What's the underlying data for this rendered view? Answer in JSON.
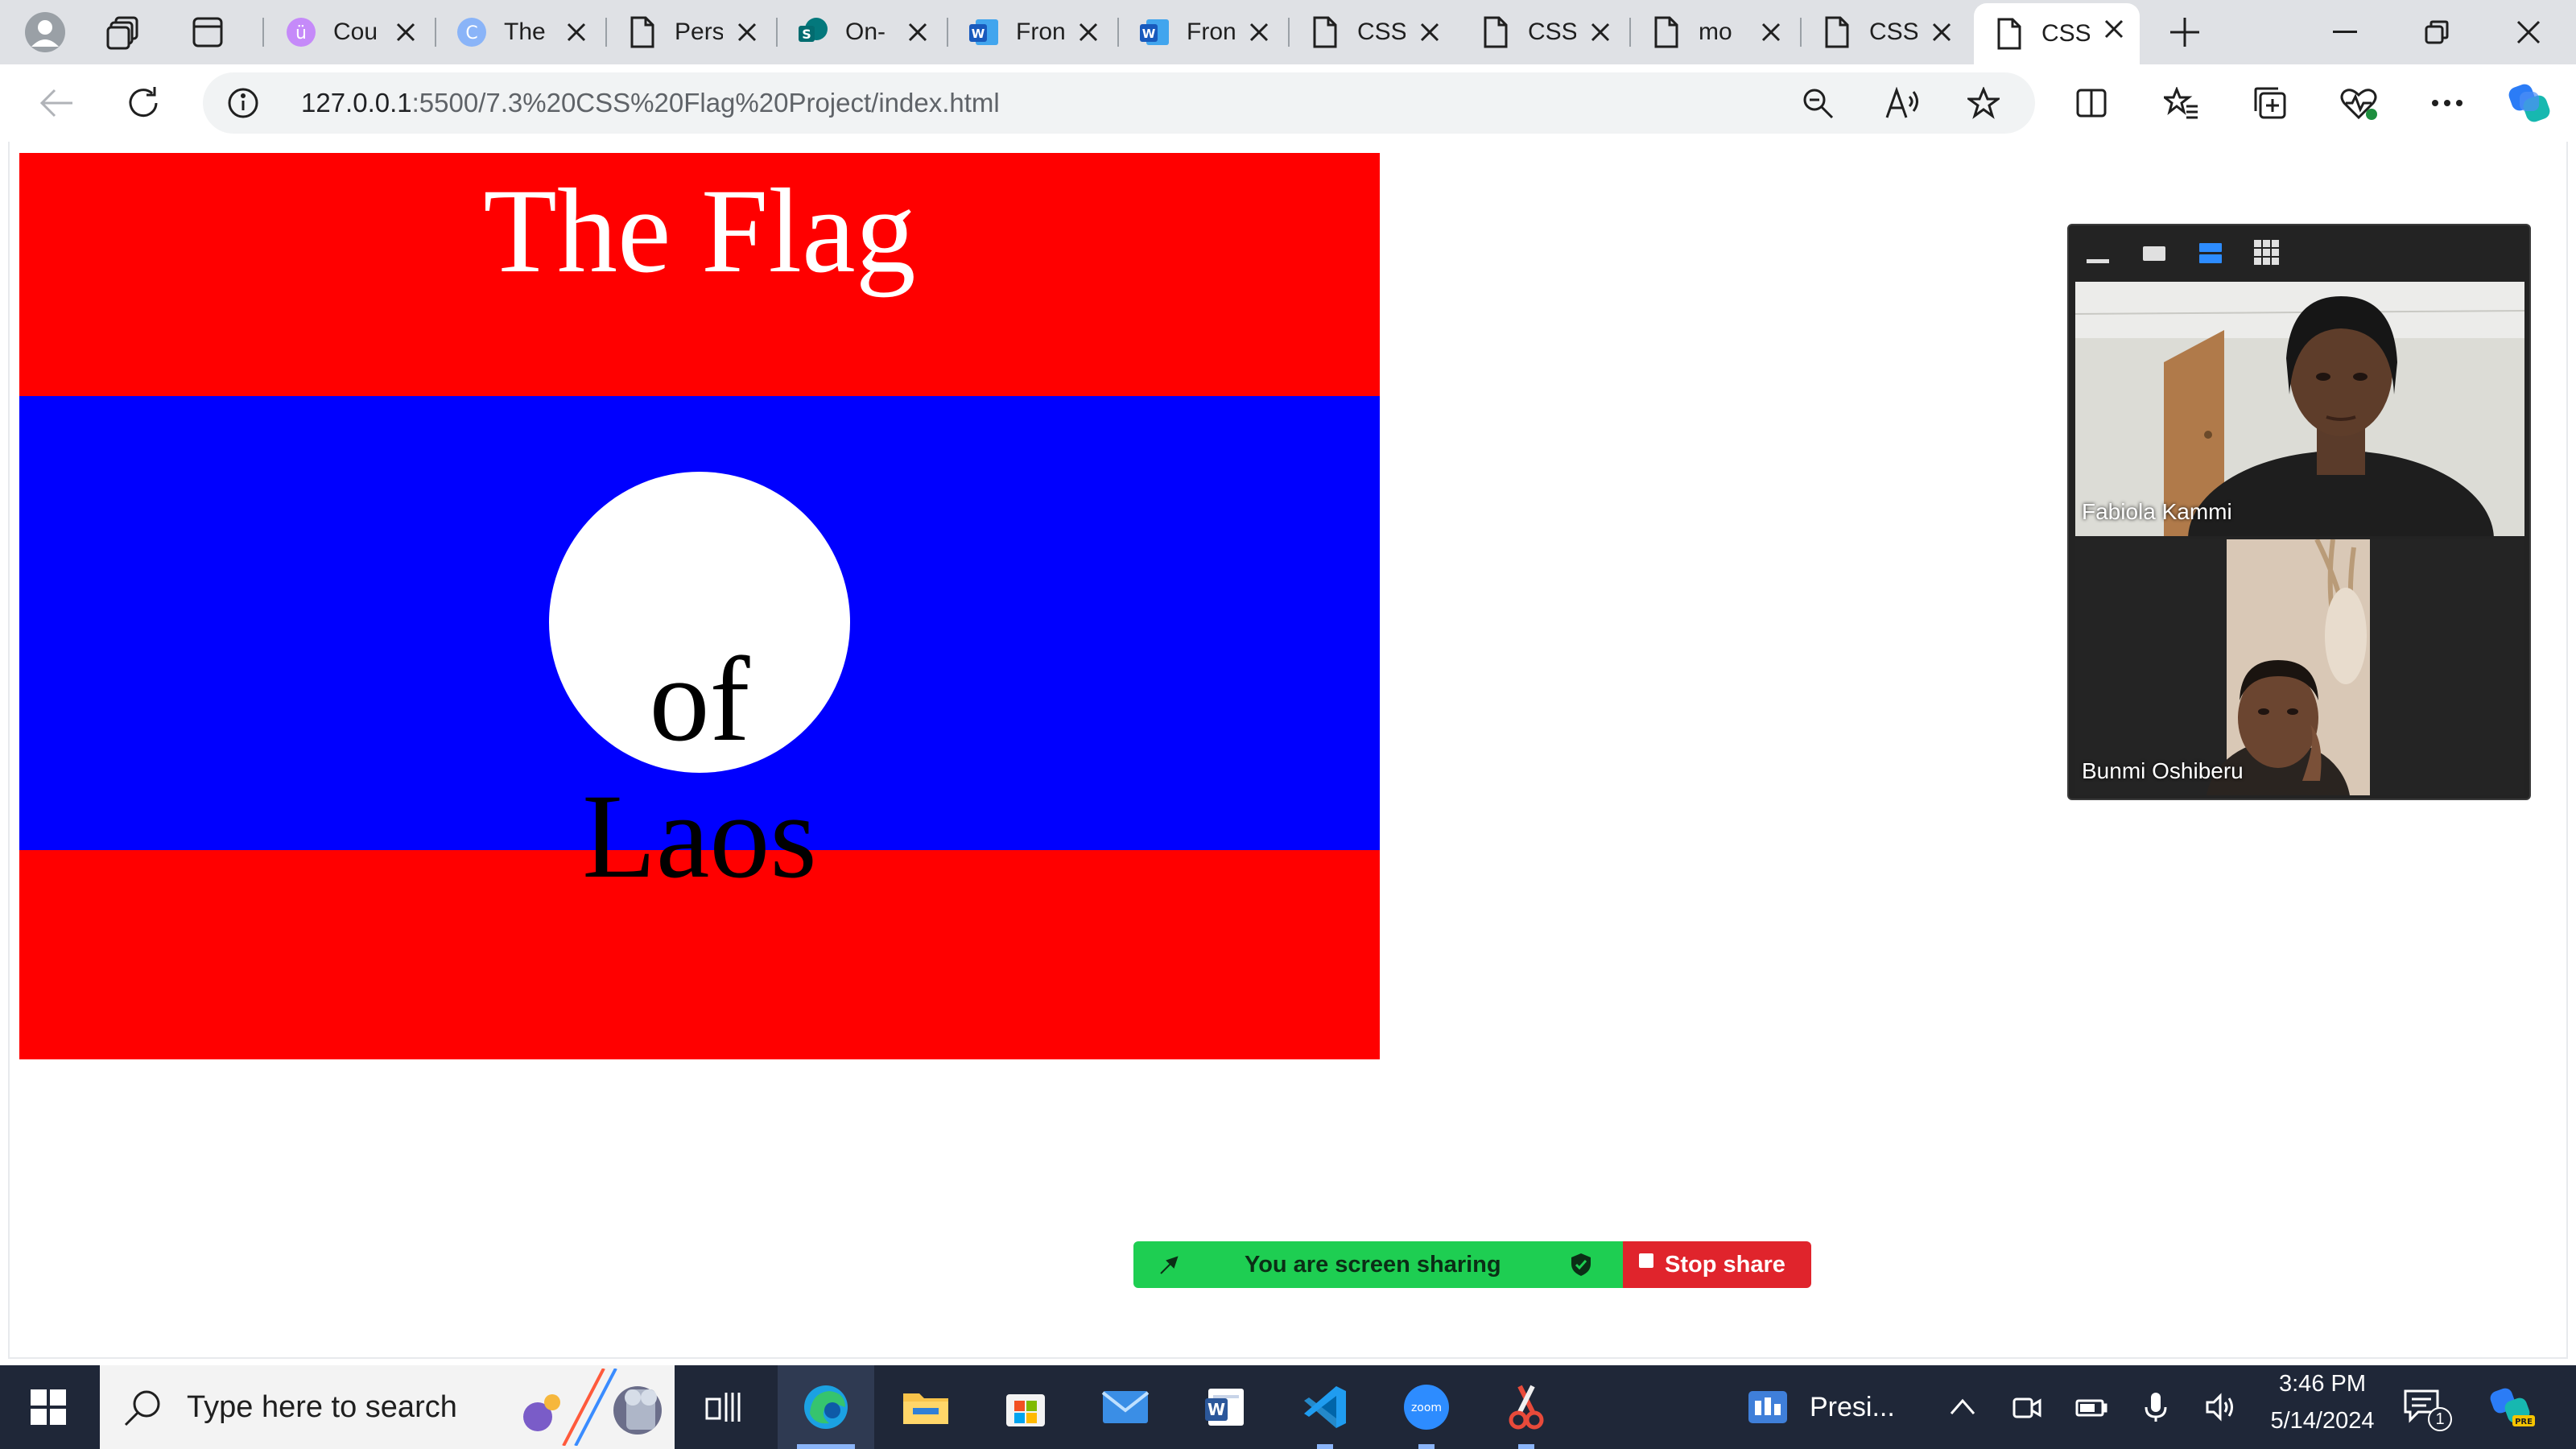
{
  "browser": {
    "tabs": [
      {
        "title": "Cou",
        "icon": "course-icon"
      },
      {
        "title": "The",
        "icon": "canva-icon"
      },
      {
        "title": "Pers",
        "icon": "page-icon"
      },
      {
        "title": "On-",
        "icon": "sharepoint-icon"
      },
      {
        "title": "Fron",
        "icon": "word-icon"
      },
      {
        "title": "Fron",
        "icon": "word-icon"
      },
      {
        "title": "CSS",
        "icon": "page-icon"
      },
      {
        "title": "CSS",
        "icon": "page-icon"
      },
      {
        "title": "mo",
        "icon": "page-icon"
      },
      {
        "title": "CSS",
        "icon": "page-icon"
      },
      {
        "title": "CSS",
        "icon": "page-icon",
        "active": true
      }
    ],
    "url_host": "127.0.0.1",
    "url_path": ":5500/7.3%20CSS%20Flag%20Project/index.html"
  },
  "page": {
    "title": "The Flag",
    "circle_line1": "of",
    "circle_line2": "Laos",
    "colors": {
      "red": "#ff0000",
      "blue": "#0000ff",
      "white": "#ffffff"
    }
  },
  "zoom": {
    "participants": [
      {
        "name": "Fabiola Kammi"
      },
      {
        "name": "Bunmi Oshiberu"
      }
    ],
    "share_status": "You are screen sharing",
    "stop_share": "Stop share"
  },
  "taskbar": {
    "search_placeholder": "Type here to search",
    "pinned_label": "Presi...",
    "time": "3:46 PM",
    "date": "5/14/2024",
    "notification_count": "1"
  }
}
